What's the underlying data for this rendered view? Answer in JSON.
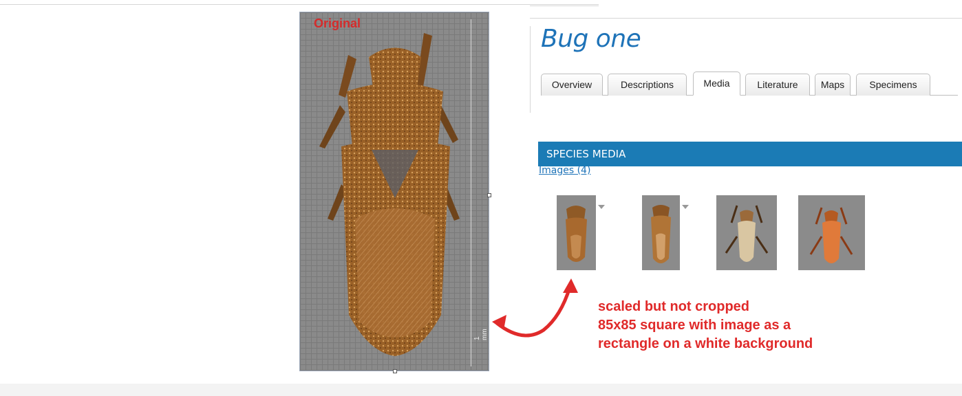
{
  "original": {
    "label": "Original"
  },
  "page": {
    "title": "Bug one"
  },
  "tabs": [
    {
      "label": "Overview",
      "active": false
    },
    {
      "label": "Descriptions",
      "active": false
    },
    {
      "label": "Media",
      "active": true
    },
    {
      "label": "Literature",
      "active": false
    },
    {
      "label": "Maps",
      "active": false
    },
    {
      "label": "Specimens",
      "active": false
    }
  ],
  "media": {
    "section_title": "SPECIES MEDIA",
    "images_link": "Images (4)"
  },
  "annotation": {
    "lines": [
      "scaled but not cropped",
      "85x85 square with image as a",
      "rectangle on a white background"
    ]
  },
  "colors": {
    "accent_blue": "#1b7bb5",
    "title_blue": "#1e73b8",
    "annotation_red": "#e02a2a",
    "thumb_gray": "#8b8b8b"
  },
  "icons": [
    "dropdown-arrow-icon",
    "curved-double-arrow-icon"
  ]
}
